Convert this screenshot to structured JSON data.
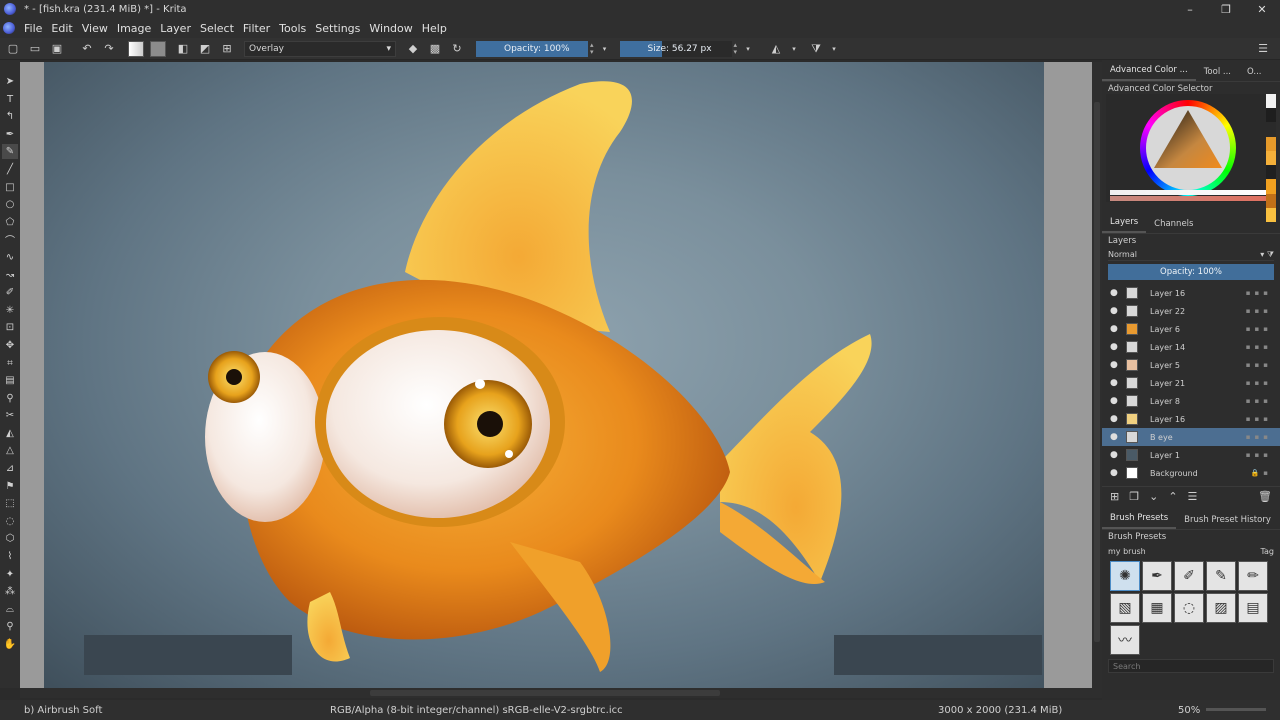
{
  "window": {
    "title": "* - [fish.kra (231.4 MiB) *] - Krita",
    "controls": [
      "–",
      "❐",
      "✕"
    ]
  },
  "menu": [
    "File",
    "Edit",
    "View",
    "Image",
    "Layer",
    "Select",
    "Filter",
    "Tools",
    "Settings",
    "Window",
    "Help"
  ],
  "toolbar": {
    "blend_mode": "Overlay",
    "opacity_label": "Opacity: 100%",
    "size_label": "Size: 56.27 px"
  },
  "docker": {
    "top_tabs": [
      "Advanced Color ...",
      "Tool ...",
      "O..."
    ],
    "color_selector_title": "Advanced Color Selector",
    "layer_tabs": [
      "Layers",
      "Channels"
    ],
    "layers_title": "Layers",
    "layer_blend": "Normal",
    "layer_opacity": "Opacity:  100%",
    "layers": [
      {
        "name": "Layer 16",
        "selected": false
      },
      {
        "name": "Layer 22",
        "selected": false
      },
      {
        "name": "Layer 6",
        "selected": false
      },
      {
        "name": "Layer 14",
        "selected": false
      },
      {
        "name": "Layer 5",
        "selected": false
      },
      {
        "name": "Layer 21",
        "selected": false
      },
      {
        "name": "Layer 8",
        "selected": false
      },
      {
        "name": "Layer 16",
        "selected": false
      },
      {
        "name": "B eye",
        "selected": true
      },
      {
        "name": "Layer 1",
        "selected": false
      },
      {
        "name": "Background",
        "selected": false
      }
    ],
    "brush_tabs": [
      "Brush Presets",
      "Brush Preset History"
    ],
    "brush_presets_title": "Brush Presets",
    "brush_tag": "my brush",
    "tag_label": "Tag",
    "search_placeholder": "Search"
  },
  "status": {
    "brush": "b) Airbrush Soft",
    "color_space": "RGB/Alpha (8-bit integer/channel)  sRGB-elle-V2-srgbtrc.icc",
    "image_size": "3000 x 2000 (231.4 MiB)",
    "zoom": "50%"
  }
}
